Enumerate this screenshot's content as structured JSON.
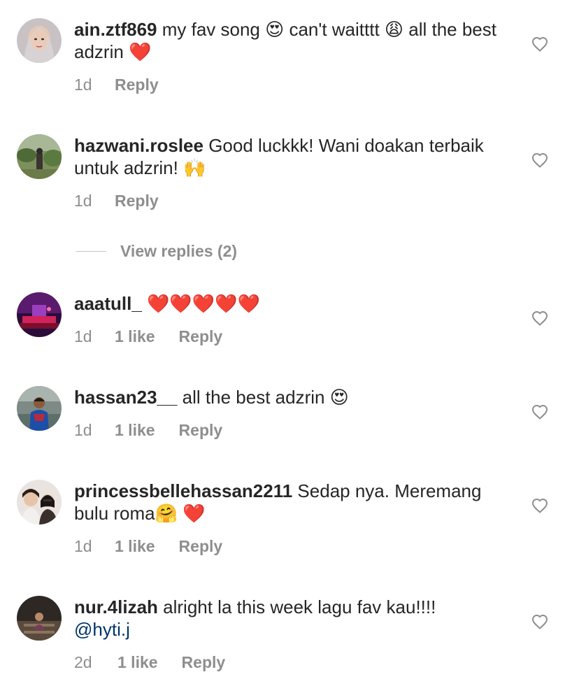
{
  "comments": [
    {
      "username": "ain.ztf869",
      "text": " my fav song 😍 can't waitttt 😩 all the best adzrin ❤️",
      "time": "1d",
      "likes": "",
      "reply_label": "Reply"
    },
    {
      "username": "hazwani.roslee",
      "text": " Good luckkk!  Wani doakan terbaik untuk adzrin! 🙌",
      "time": "1d",
      "likes": "",
      "reply_label": "Reply"
    },
    {
      "username": "aaatull_",
      "text": " ❤️❤️❤️❤️❤️",
      "time": "1d",
      "likes": "1 like",
      "reply_label": "Reply"
    },
    {
      "username": "hassan23__",
      "text": " all the best adzrin 😍",
      "time": "1d",
      "likes": "1 like",
      "reply_label": "Reply"
    },
    {
      "username": "princessbellehassan2211",
      "text": " Sedap nya. Meremang bulu roma🤗 ❤️",
      "time": "1d",
      "likes": "1 like",
      "reply_label": "Reply"
    },
    {
      "username": "nur.4lizah",
      "text": " alright la this week lagu fav kau!!!! ",
      "mention": "@hyti.j",
      "time": "2d",
      "likes": "1 like",
      "reply_label": "Reply"
    }
  ],
  "view_replies": "View replies (2)",
  "icons": {
    "like": "heart-outline-icon"
  },
  "colors": {
    "text": "#262626",
    "meta": "#8e8e8e",
    "mention": "#003569"
  }
}
